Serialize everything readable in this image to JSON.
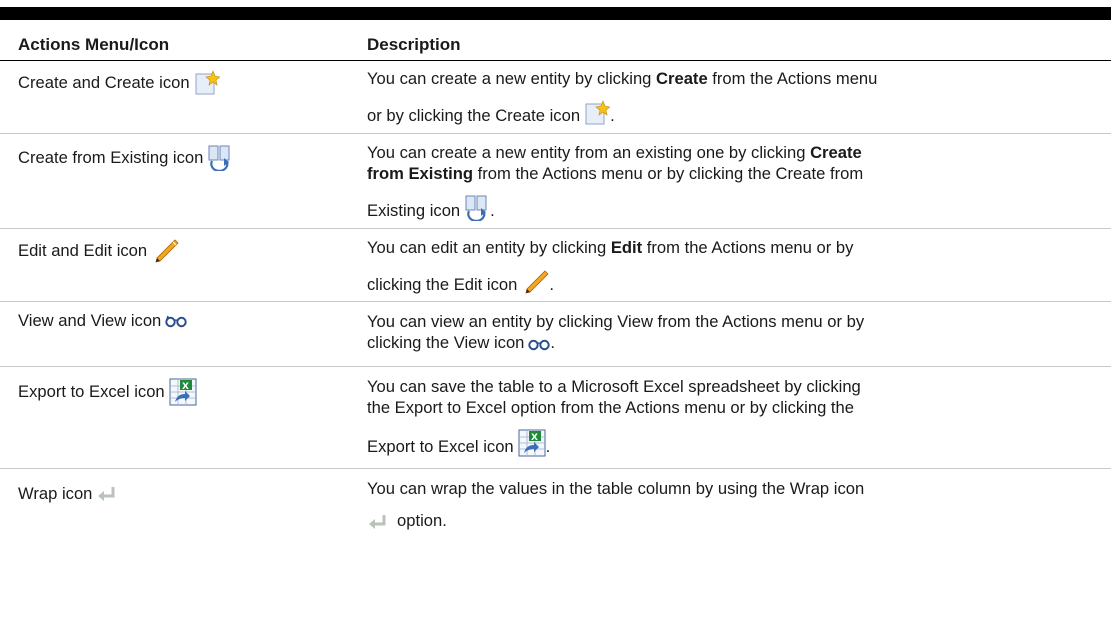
{
  "table": {
    "headers": {
      "action": "Actions Menu/Icon",
      "description": "Description"
    },
    "rows": [
      {
        "action_label": "Create and Create icon",
        "icon": "create-icon",
        "desc_a": "You can create a new entity by clicking ",
        "desc_b": "Create",
        "desc_c": " from the Actions menu",
        "desc_d": "or by clicking the Create icon",
        "desc_e": "."
      },
      {
        "action_label": "Create from Existing icon",
        "icon": "create-from-existing-icon",
        "desc_a": "You can create a new entity from an existing one by clicking ",
        "desc_b": "Create",
        "desc_c": "from Existing",
        "desc_d": " from the Actions menu or by clicking the Create from",
        "desc_e": "Existing icon",
        "desc_f": "."
      },
      {
        "action_label": "Edit and Edit icon",
        "icon": "edit-pencil-icon",
        "desc_a": "You can edit an entity by clicking ",
        "desc_b": "Edit",
        "desc_c": " from the Actions menu or by",
        "desc_d": "clicking the Edit icon",
        "desc_e": "."
      },
      {
        "action_label": "View and View icon",
        "icon": "view-glasses-icon",
        "desc_a": "You can view an entity by clicking View from the Actions menu or by",
        "desc_b": "clicking the View icon",
        "desc_c": "."
      },
      {
        "action_label": "Export to Excel icon",
        "icon": "export-excel-icon",
        "desc_a": "You can save the table to a Microsoft Excel spreadsheet by clicking",
        "desc_b": "the Export to Excel option from the Actions menu or by clicking the",
        "desc_c": "Export to Excel icon",
        "desc_d": "."
      },
      {
        "action_label": "Wrap icon",
        "icon": "wrap-arrow-icon",
        "desc_a": "You can wrap the values in the table column by using the Wrap icon",
        "desc_b": "option."
      }
    ]
  }
}
